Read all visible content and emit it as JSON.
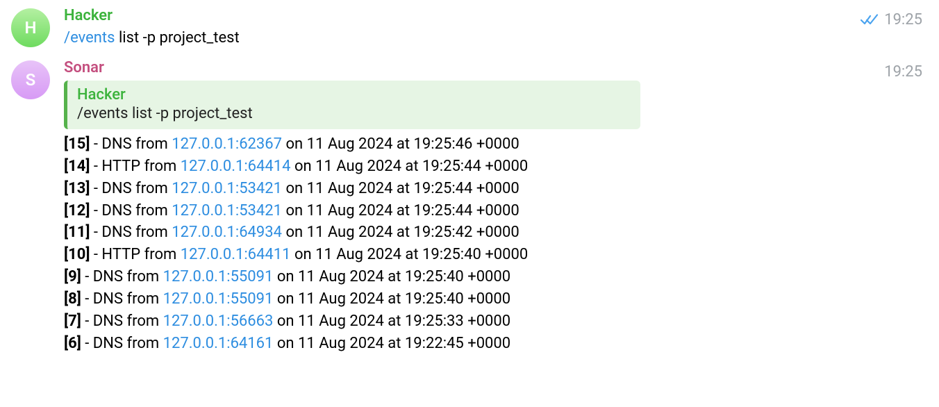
{
  "msg1": {
    "sender_name": "Hacker",
    "avatar_letter": "H",
    "time": "19:25",
    "read": true,
    "command": "/events",
    "command_rest": " list -p project_test"
  },
  "msg2": {
    "sender_name": "Sonar",
    "avatar_letter": "S",
    "time": "19:25",
    "reply_to_name": "Hacker",
    "reply_command": "/events",
    "reply_command_rest": " list -p project_test",
    "events": [
      {
        "id": "15",
        "proto": "DNS",
        "src": "127.0.0.1:62367",
        "ts": "11 Aug 2024 at 19:25:46 +0000"
      },
      {
        "id": "14",
        "proto": "HTTP",
        "src": "127.0.0.1:64414",
        "ts": "11 Aug 2024 at 19:25:44 +0000"
      },
      {
        "id": "13",
        "proto": "DNS",
        "src": "127.0.0.1:53421",
        "ts": "11 Aug 2024 at 19:25:44 +0000"
      },
      {
        "id": "12",
        "proto": "DNS",
        "src": "127.0.0.1:53421",
        "ts": "11 Aug 2024 at 19:25:44 +0000"
      },
      {
        "id": "11",
        "proto": "DNS",
        "src": "127.0.0.1:64934",
        "ts": "11 Aug 2024 at 19:25:42 +0000"
      },
      {
        "id": "10",
        "proto": "HTTP",
        "src": "127.0.0.1:64411",
        "ts": "11 Aug 2024 at 19:25:40 +0000"
      },
      {
        "id": "9",
        "proto": "DNS",
        "src": "127.0.0.1:55091",
        "ts": "11 Aug 2024 at 19:25:40 +0000"
      },
      {
        "id": "8",
        "proto": "DNS",
        "src": "127.0.0.1:55091",
        "ts": "11 Aug 2024 at 19:25:40 +0000"
      },
      {
        "id": "7",
        "proto": "DNS",
        "src": "127.0.0.1:56663",
        "ts": "11 Aug 2024 at 19:25:33 +0000"
      },
      {
        "id": "6",
        "proto": "DNS",
        "src": "127.0.0.1:64161",
        "ts": "11 Aug 2024 at 19:22:45 +0000"
      }
    ]
  }
}
